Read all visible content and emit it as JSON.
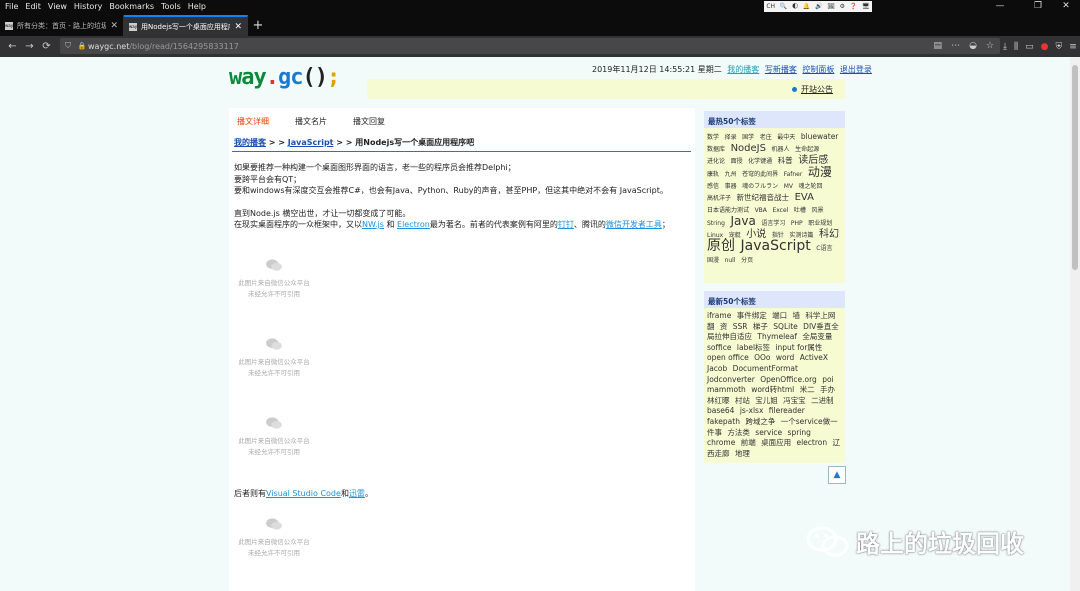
{
  "menu": [
    "File",
    "Edit",
    "View",
    "History",
    "Bookmarks",
    "Tools",
    "Help"
  ],
  "tray": [
    "CH",
    "🔍",
    "🌓",
    "🔔",
    "🔊",
    "🖼",
    "⚙",
    "❓",
    "🖥"
  ],
  "window": {
    "minimize": "—",
    "restore": "❐",
    "close": "✕"
  },
  "tabs": [
    {
      "favicon": "tab-favicon-icon",
      "title": "所有分类：首页 - 路上的垃圾回",
      "close": "✕"
    },
    {
      "favicon": "tab-favicon-icon",
      "title": "用Nodejs写一个桌面应用程序",
      "close": "✕"
    }
  ],
  "newtab": "+",
  "nav": {
    "back": "←",
    "forward": "→",
    "reload": "⟳",
    "home": "⌂"
  },
  "url": {
    "host": "waygc.net",
    "path": "/blog/read/1564295833117"
  },
  "site": {
    "logo": {
      "w": "way",
      "dot": ".",
      "g": "gc",
      "paren": "()",
      "semi": ";"
    },
    "datetime": "2019年11月12日 14:55:21 星期二",
    "links": [
      "我的播客",
      "写新播客",
      "控制面板",
      "退出登录"
    ],
    "notice": "开站公告"
  },
  "post_tabs": [
    "播文详细",
    "播文名片",
    "播文回复"
  ],
  "breadcrumb": {
    "home": "我的播客",
    "sep1": " > > ",
    "category": "JavaScript",
    "sep2": " > > ",
    "title": "用Nodejs写一个桌面应用程序吧"
  },
  "article": {
    "p1": "如果要推荐一种构建一个桌面图形界面的语言，老一些的程序员会推荐Delphi；",
    "p2": "要跨平台会有QT；",
    "p3": "要和windows有深度交互会推荐C#，也会有Java、Python、Ruby的声音，甚至PHP，但这其中绝对不会有 JavaScript。",
    "p4": "直到Node.js 横空出世，才让一切都变成了可能。",
    "p5a": "在现实桌面程序的一众框架中，又以",
    "p5_link1": "NW.js",
    "p5b": " 和 ",
    "p5_link2": "Electron",
    "p5c": "最为著名。前者的代表案例有阿里的",
    "p5_link3": "钉钉",
    "p5d": "、腾讯的",
    "p5_link4": "微信开发者工具",
    "p5e": "；"
  },
  "image_placeholder": {
    "line1": "此图片来自微信公众平台",
    "line2": "未经允许不可引用"
  },
  "after": {
    "prefix": "后者则有",
    "link1": "Visual Studio Code",
    "mid": "和",
    "link2": "迅雷",
    "suffix": "。"
  },
  "sidebar": {
    "hot_title": "最热50个标签",
    "hot_tags": [
      [
        "数学",
        "t1"
      ],
      [
        "择录",
        "t1"
      ],
      [
        "国学",
        "t1"
      ],
      [
        "老庄",
        "t1"
      ],
      [
        "最中天",
        "t1"
      ],
      [
        "bluewater",
        "t2"
      ],
      [
        "数据库",
        "t1"
      ],
      [
        "NodeJS",
        "t3"
      ],
      [
        "机器人",
        "t1"
      ],
      [
        "生命起源",
        "t1"
      ],
      [
        "进化论",
        "t1"
      ],
      [
        "面授",
        "t1"
      ],
      [
        "化学键通",
        "t1"
      ],
      [
        "科普",
        "t2"
      ],
      [
        "读后感",
        "t3"
      ],
      [
        "康轨",
        "t1"
      ],
      [
        "九州",
        "t1"
      ],
      [
        "苍穹的此间界",
        "t1"
      ],
      [
        "Fafner",
        "t1"
      ],
      [
        "动漫",
        "t4"
      ],
      [
        "感信",
        "t1"
      ],
      [
        "事器",
        "t1"
      ],
      [
        "魂のフルラン",
        "t1"
      ],
      [
        "MV",
        "t1"
      ],
      [
        "魂之轮回",
        "t1"
      ],
      [
        "高机洋子",
        "t1"
      ],
      [
        "新世纪福音战士",
        "t2"
      ],
      [
        "EVA",
        "t3"
      ],
      [
        "日本语能力测试",
        "t1"
      ],
      [
        "VBA",
        "t1"
      ],
      [
        "Excel",
        "t1"
      ],
      [
        "吐槽",
        "t1"
      ],
      [
        "风景",
        "t1"
      ],
      [
        "String",
        "t1"
      ],
      [
        "Java",
        "t4"
      ],
      [
        "语言学习",
        "t1"
      ],
      [
        "PHP",
        "t1"
      ],
      [
        "职业规划",
        "t1"
      ],
      [
        "Linux",
        "t1"
      ],
      [
        "宠艇",
        "t1"
      ],
      [
        "小说",
        "t3"
      ],
      [
        "指针",
        "t1"
      ],
      [
        "实测诗篇",
        "t1"
      ],
      [
        "科幻",
        "t3"
      ],
      [
        "原创",
        "t5"
      ],
      [
        "JavaScript",
        "t5"
      ],
      [
        "C语言",
        "t1"
      ],
      [
        "国漫",
        "t1"
      ],
      [
        "null",
        "t1"
      ],
      [
        "分页",
        "t1"
      ]
    ],
    "new_title": "最新50个标签",
    "new_tags": [
      "iframe",
      "事件绑定",
      "端口",
      "墙",
      "科学上网",
      "翻",
      "资",
      "SSR",
      "梯子",
      "SQLite",
      "DIV垂直全局拉伸自适应",
      "Thymeleaf",
      "全局变量",
      "soffice",
      "label标签",
      "input for属性",
      "open office",
      "OOo",
      "word",
      "ActiveX",
      "Jacob",
      "DocumentFormat",
      "Jodconverter",
      "OpenOffice.org",
      "poi",
      "mammoth",
      "word转html",
      "米二",
      "手办",
      "林红曝",
      "村站",
      "宝儿姐",
      "冯宝宝",
      "二进制",
      "base64",
      "js-xlsx",
      "filereader",
      "fakepath",
      "跨域之争",
      "一个service做一件事",
      "方法类",
      "service",
      "spring",
      "chrome",
      "前端",
      "桌面应用",
      "electron",
      "辽西走廊",
      "地理"
    ],
    "top_button": "▲"
  },
  "watermark": "路上的垃圾回收",
  "colors": {
    "accent": "#1a7ad0",
    "link": "#1a90e0",
    "active_tab": "#e04000",
    "sidebar_head": "#dde6fb",
    "sidebar_body": "#f6fbd2"
  }
}
